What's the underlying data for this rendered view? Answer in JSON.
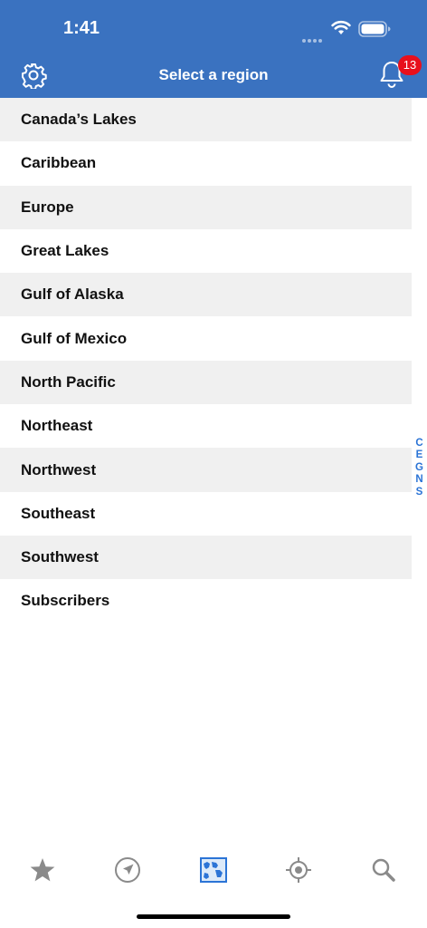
{
  "status_bar": {
    "time": "1:41"
  },
  "header": {
    "title": "Select a region",
    "notification_count": "13"
  },
  "regions": [
    "Canada’s Lakes",
    "Caribbean",
    "Europe",
    "Great Lakes",
    "Gulf of Alaska",
    "Gulf of Mexico",
    "North Pacific",
    "Northeast",
    "Northwest",
    "Southeast",
    "Southwest",
    "Subscribers"
  ],
  "index_letters": [
    "C",
    "E",
    "G",
    "N",
    "S"
  ],
  "tabbar": {
    "tabs": [
      {
        "icon": "star-icon"
      },
      {
        "icon": "navigation-arrow-icon"
      },
      {
        "icon": "map-icon",
        "selected": true
      },
      {
        "icon": "location-target-icon"
      },
      {
        "icon": "search-icon"
      }
    ]
  },
  "colors": {
    "header_bg": "#3a72c0",
    "row_alt_bg": "#f0f0f0",
    "accent": "#2b74d6",
    "badge": "#e8101c"
  }
}
